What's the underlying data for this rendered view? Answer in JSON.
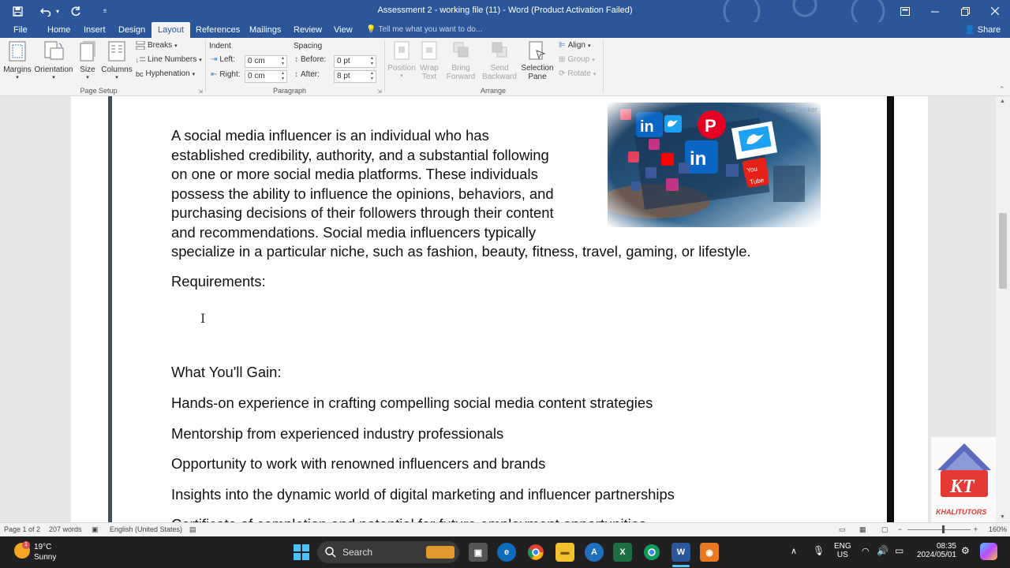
{
  "titlebar": {
    "title": "Assessment 2 - working file (11) - Word (Product Activation Failed)"
  },
  "tabs": [
    "File",
    "Home",
    "Insert",
    "Design",
    "Layout",
    "References",
    "Mailings",
    "Review",
    "View"
  ],
  "active_tab": "Layout",
  "tell_me": "Tell me what you want to do...",
  "share_label": "Share",
  "ribbon": {
    "page_setup": {
      "margins": "Margins",
      "orientation": "Orientation",
      "size": "Size",
      "columns": "Columns",
      "breaks": "Breaks",
      "line_numbers": "Line Numbers",
      "hyphenation": "Hyphenation",
      "group_label": "Page Setup"
    },
    "paragraph": {
      "indent_label": "Indent",
      "left_label": "Left:",
      "left_value": "0 cm",
      "right_label": "Right:",
      "right_value": "0 cm",
      "spacing_label": "Spacing",
      "before_label": "Before:",
      "before_value": "0 pt",
      "after_label": "After:",
      "after_value": "8 pt",
      "group_label": "Paragraph"
    },
    "arrange": {
      "position": "Position",
      "wrap_text_1": "Wrap",
      "wrap_text_2": "Text",
      "bring_forward_1": "Bring",
      "bring_forward_2": "Forward",
      "send_backward_1": "Send",
      "send_backward_2": "Backward",
      "selection_pane_1": "Selection",
      "selection_pane_2": "Pane",
      "align": "Align",
      "group": "Group",
      "rotate": "Rotate",
      "group_label": "Arrange"
    }
  },
  "document": {
    "para1_lines": [
      "A social media influencer is an individual who has",
      "established credibility, authority, and a substantial following",
      "on one or more social media platforms. These individuals",
      "possess the ability to influence the opinions, behaviors, and",
      "purchasing decisions of their followers through their content",
      "and recommendations. Social media influencers typically"
    ],
    "para1_last": "specialize in a particular niche, such as fashion, beauty, fitness, travel, gaming, or lifestyle.",
    "requirements": "Requirements:",
    "gain_heading": "What You'll Gain:",
    "gains": [
      "Hands-on experience in crafting compelling social media content strategies",
      "Mentorship from experienced industry professionals",
      "Opportunity to work with renowned influencers and brands",
      "Insights into the dynamic world of digital marketing and influencer partnerships"
    ],
    "cut_line": "Certificate of completion and potential for future employment opportunities",
    "image_watermark": "talkwalker"
  },
  "logo": {
    "letters": "KT",
    "name": "KHALITUTORS"
  },
  "statusbar": {
    "page": "Page 1 of 2",
    "words": "207 words",
    "language": "English (United States)",
    "zoom": "160%"
  },
  "taskbar": {
    "weather_temp": "19°C",
    "weather_desc": "Sunny",
    "weather_badge": "1",
    "search_label": "Search",
    "lang_1": "ENG",
    "lang_2": "US",
    "time": "08:35",
    "date": "2024/05/01"
  }
}
